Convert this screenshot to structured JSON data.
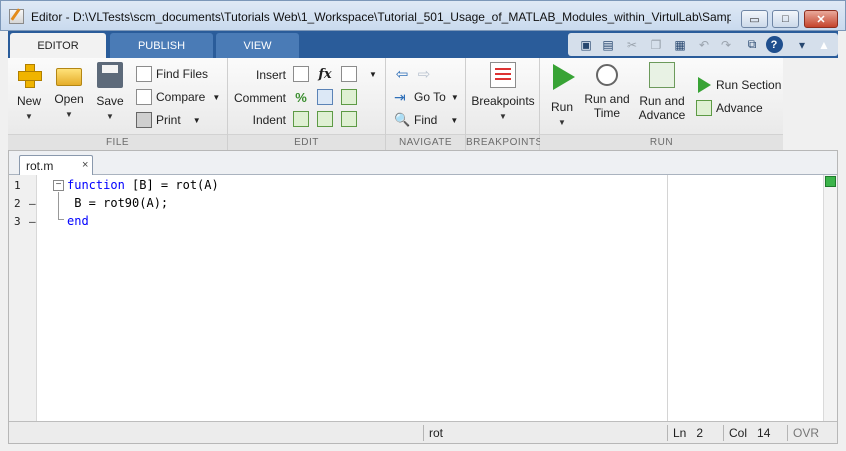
{
  "window": {
    "title": "Editor - D:\\VLTests\\scm_documents\\Tutorials Web\\1_Workspace\\Tutorial_501_Usage_of_MATLAB_Modules_within_VirtulLab\\Sampl...",
    "min_symbol": "▭",
    "max_symbol": "□",
    "close_symbol": "✕"
  },
  "tabs": [
    {
      "label": "EDITOR"
    },
    {
      "label": "PUBLISH"
    },
    {
      "label": "VIEW"
    }
  ],
  "quick_access": {
    "help_symbol": "?",
    "menu_symbol": "▾",
    "pin_symbol": "▲"
  },
  "ribbon": {
    "file": {
      "label": "FILE",
      "new": "New",
      "open": "Open",
      "save": "Save",
      "find_files": "Find Files",
      "compare": "Compare",
      "print": "Print"
    },
    "edit": {
      "label": "EDIT",
      "insert": "Insert",
      "comment": "Comment",
      "indent": "Indent",
      "fx_symbol": "fx",
      "percent_symbol": "%"
    },
    "navigate": {
      "label": "NAVIGATE",
      "goto": "Go To",
      "find": "Find"
    },
    "breakpoints": {
      "label": "BREAKPOINTS",
      "breakpoints": "Breakpoints"
    },
    "run": {
      "label": "RUN",
      "run": "Run",
      "run_and_time_line1": "Run and",
      "run_and_time_line2": "Time",
      "run_and_advance_line1": "Run and",
      "run_and_advance_line2": "Advance",
      "run_section": "Run Section",
      "advance": "Advance"
    }
  },
  "document": {
    "tab_name": "rot.m",
    "tab_close": "×",
    "fold_symbol": "−",
    "lines": [
      {
        "num": "1",
        "marker": ""
      },
      {
        "num": "2",
        "marker": "–"
      },
      {
        "num": "3",
        "marker": "–"
      }
    ],
    "code": {
      "line1_keyword": "function",
      "line1_rest": " [B] = rot(A)",
      "line2": " B = rot90(A);",
      "line3_keyword": "end"
    }
  },
  "status": {
    "function_name": "rot",
    "ln_label": "Ln",
    "ln_value": "2",
    "col_label": "Col",
    "col_value": "14",
    "mode": "OVR"
  },
  "colors": {
    "keyword": "#0000ff",
    "tabstrip": "#2a5c9a",
    "run_green": "#38a335"
  }
}
